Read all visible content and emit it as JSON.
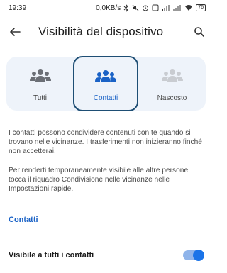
{
  "status_bar": {
    "time": "19:39",
    "net_speed": "0,0KB/s",
    "battery": "76"
  },
  "header": {
    "title": "Visibilità del dispositivo"
  },
  "visibility_options": [
    {
      "label": "Tutti",
      "icon": "people-group-icon",
      "selected": false
    },
    {
      "label": "Contatti",
      "icon": "people-group-icon",
      "selected": true
    },
    {
      "label": "Nascosto",
      "icon": "people-group-disabled-icon",
      "selected": false
    }
  ],
  "description": {
    "p1": "I contatti possono condividere contenuti con te quando si trovano nelle vicinanze. I trasferimenti non inizieranno finché non accetterai.",
    "p2": "Per renderti temporaneamente visibile alle altre persone, tocca il riquadro Condivisione nelle vicinanze nelle Impostazioni rapide."
  },
  "contacts_section": {
    "header": "Contatti",
    "toggle_label": "Visibile a tutti i contatti",
    "toggle_on": true
  },
  "colors": {
    "accent": "#1a73e8",
    "link": "#1a62c6",
    "card_bg": "#eef3fa",
    "selected_border": "#1e4e74",
    "icon_gray": "#6b6f76",
    "icon_disabled": "#c9ccd1"
  }
}
